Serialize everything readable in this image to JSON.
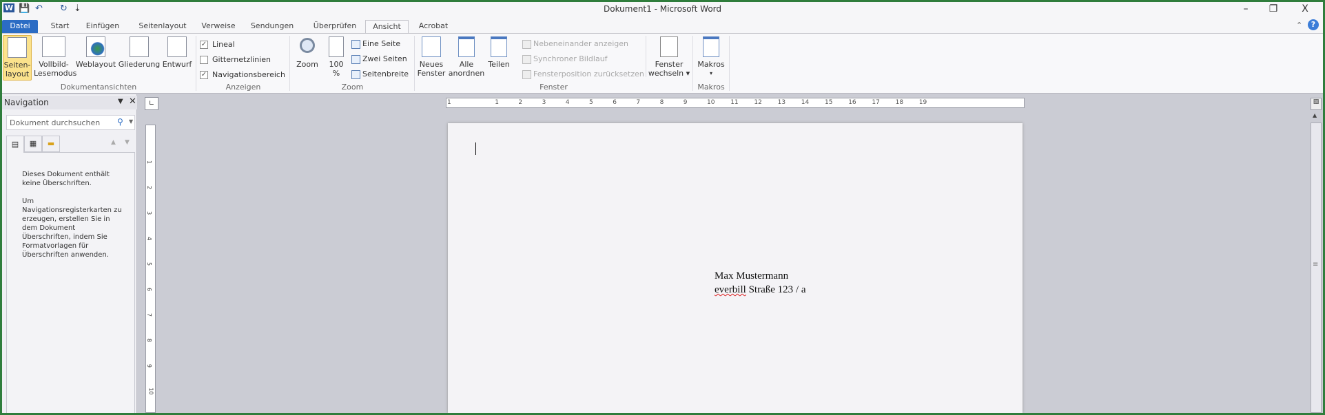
{
  "window": {
    "title": "Dokument1 - Microsoft Word",
    "minimize": "–",
    "restore": "❐",
    "close": "X"
  },
  "qat": {
    "app_icon": "W",
    "save": "💾",
    "undo": "↶",
    "redo": "↻",
    "customize": "⇣"
  },
  "tabs": [
    "Datei",
    "Start",
    "Einfügen",
    "Seitenlayout",
    "Verweise",
    "Sendungen",
    "Überprüfen",
    "Ansicht",
    "Acrobat"
  ],
  "active_tab": "Ansicht",
  "ribbon": {
    "dokumentansichten": {
      "label": "Dokumentansichten",
      "buttons": [
        {
          "line1": "Seiten-",
          "line2": "layout"
        },
        {
          "line1": "Vollbild-",
          "line2": "Lesemodus"
        },
        {
          "line1": "Weblayout",
          "line2": ""
        },
        {
          "line1": "Gliederung",
          "line2": ""
        },
        {
          "line1": "Entwurf",
          "line2": ""
        }
      ]
    },
    "anzeigen": {
      "label": "Anzeigen",
      "items": [
        {
          "label": "Lineal",
          "checked": true,
          "mark": "✓"
        },
        {
          "label": "Gitternetzlinien",
          "checked": false,
          "mark": ""
        },
        {
          "label": "Navigationsbereich",
          "checked": true,
          "mark": "✓"
        }
      ]
    },
    "zoom": {
      "label": "Zoom",
      "zoom": "Zoom",
      "hundred_line1": "100",
      "hundred_line2": "%",
      "items": [
        "Eine Seite",
        "Zwei Seiten",
        "Seitenbreite"
      ]
    },
    "fenster": {
      "label": "Fenster",
      "neues_line1": "Neues",
      "neues_line2": "Fenster",
      "alle_line1": "Alle",
      "alle_line2": "anordnen",
      "teilen": "Teilen",
      "disabled_items": [
        "Nebeneinander anzeigen",
        "Synchroner Bildlauf",
        "Fensterposition zurücksetzen"
      ],
      "wechseln_line1": "Fenster",
      "wechseln_line2": "wechseln ▾"
    },
    "makros": {
      "label": "Makros",
      "button": "Makros",
      "arrow": "▾"
    }
  },
  "navigation": {
    "title": "Navigation",
    "search_placeholder": "Dokument durchsuchen",
    "message1": "Dieses Dokument enthält keine Überschriften.",
    "message2": "Um Navigationsregisterkarten zu erzeugen, erstellen Sie in dem Dokument Überschriften, indem Sie Formatvorlagen für Überschriften anwenden."
  },
  "ruler": {
    "numbers": [
      "1",
      "1",
      "2",
      "3",
      "4",
      "5",
      "6",
      "7",
      "8",
      "9",
      "10",
      "11",
      "12",
      "13",
      "14",
      "15",
      "16",
      "17",
      "18",
      "19"
    ]
  },
  "document": {
    "line1": "Max Mustermann",
    "line2_misspelled": "everbill",
    "line2_rest": " Straße 123 / a"
  },
  "colors": {
    "frame": "#2f7d3c",
    "file_tab": "#2b6cc4",
    "selected_view": "#fbe28c"
  }
}
